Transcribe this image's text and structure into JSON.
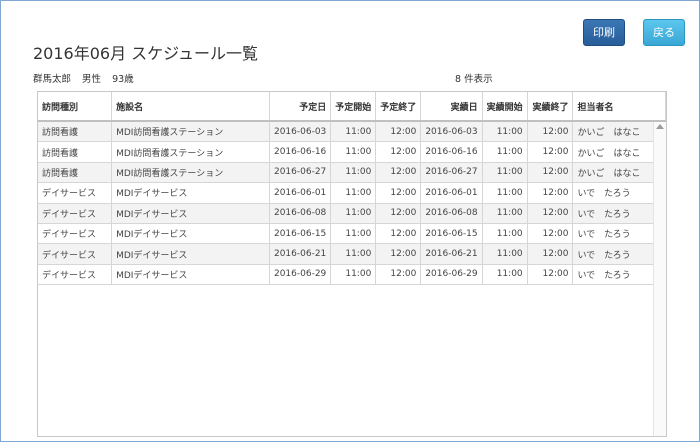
{
  "header": {
    "print_label": "印刷",
    "back_label": "戻る",
    "title": "2016年06月 スケジュール一覧"
  },
  "info": {
    "name": "群馬太郎",
    "gender": "男性",
    "age": "93歳",
    "count": "8 件表示"
  },
  "table": {
    "columns": [
      "訪問種別",
      "施設名",
      "予定日",
      "予定開始",
      "予定終了",
      "実績日",
      "実績開始",
      "実績終了",
      "担当者名"
    ],
    "rows": [
      [
        "訪問看護",
        "MDI訪問看護ステーション",
        "2016-06-03",
        "11:00",
        "12:00",
        "2016-06-03",
        "11:00",
        "12:00",
        "かいご　はなこ"
      ],
      [
        "訪問看護",
        "MDI訪問看護ステーション",
        "2016-06-16",
        "11:00",
        "12:00",
        "2016-06-16",
        "11:00",
        "12:00",
        "かいご　はなこ"
      ],
      [
        "訪問看護",
        "MDI訪問看護ステーション",
        "2016-06-27",
        "11:00",
        "12:00",
        "2016-06-27",
        "11:00",
        "12:00",
        "かいご　はなこ"
      ],
      [
        "デイサービス",
        "MDIデイサービス",
        "2016-06-01",
        "11:00",
        "12:00",
        "2016-06-01",
        "11:00",
        "12:00",
        "いで　たろう"
      ],
      [
        "デイサービス",
        "MDIデイサービス",
        "2016-06-08",
        "11:00",
        "12:00",
        "2016-06-08",
        "11:00",
        "12:00",
        "いで　たろう"
      ],
      [
        "デイサービス",
        "MDIデイサービス",
        "2016-06-15",
        "11:00",
        "12:00",
        "2016-06-15",
        "11:00",
        "12:00",
        "いで　たろう"
      ],
      [
        "デイサービス",
        "MDIデイサービス",
        "2016-06-21",
        "11:00",
        "12:00",
        "2016-06-21",
        "11:00",
        "12:00",
        "いで　たろう"
      ],
      [
        "デイサービス",
        "MDIデイサービス",
        "2016-06-29",
        "11:00",
        "12:00",
        "2016-06-29",
        "11:00",
        "12:00",
        "いで　たろう"
      ]
    ]
  }
}
